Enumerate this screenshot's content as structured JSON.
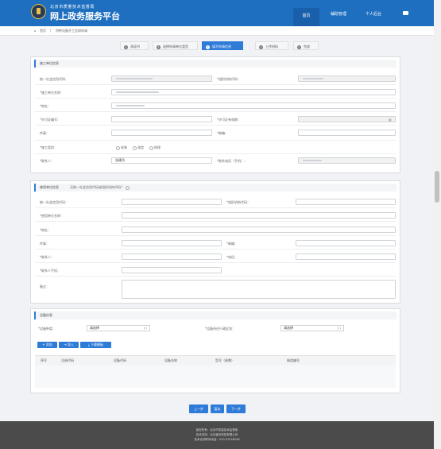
{
  "header": {
    "org": "北京市质量技术监督局",
    "title": "网上政务服务平台",
    "nav": [
      "首页",
      "辅助管理",
      "个人后台"
    ],
    "colors": {
      "primary": "#1e6fbf",
      "accent": "#2f7bd8"
    }
  },
  "breadcrumb": [
    "首页",
    "特种设备开工告知申请"
  ],
  "steps": [
    {
      "num": "1",
      "label": "承诺书"
    },
    {
      "num": "2",
      "label": "选择申请单位类型"
    },
    {
      "num": "3",
      "label": "填写申请信息"
    },
    {
      "num": "4",
      "label": "上传材料"
    },
    {
      "num": "5",
      "label": "完成"
    }
  ],
  "active_step": 3,
  "construction": {
    "title": "施工单位信息",
    "credit_code": "统一社会信用代码：",
    "org_code": "*组织机构代码：",
    "name": "*施工单位名称：",
    "address": "*地址：",
    "license_no": "*许可证编号：",
    "license_expiry": "*许可证有效期：",
    "fax": "传真：",
    "postcode": "*邮编：",
    "category": "*施工类别：",
    "category_options": [
      "安装",
      "改造",
      "修理"
    ],
    "contact": "*联系人：",
    "contact_value": "张建功",
    "phone": "*联系电话（手机）："
  },
  "user": {
    "title": "使用单位信息",
    "note": "无统一社会信用代码或组织机构代码？",
    "credit_code": "统一社会信用代码：",
    "org_code": "*组织机构代码：",
    "name": "*使用单位名称：",
    "address": "*地址：",
    "fax": "传真：",
    "postcode": "*邮编：",
    "contact": "*联系人：",
    "tel": "*电话：",
    "mobile": "*联系人手机：",
    "remark": "备注："
  },
  "equipment": {
    "title": "设备信息",
    "type_label": "*设备种类：",
    "type_value": "请选择",
    "district_label": "*设备所在行政区划：",
    "district_value": "请选择",
    "buttons": [
      "+ 添加",
      "导入",
      "下载模板"
    ],
    "columns": [
      "序号",
      "注册代码",
      "设备代码",
      "设备名称",
      "型号（参数）",
      "制造编号"
    ]
  },
  "actions": [
    "上一步",
    "暂存",
    "下一步"
  ],
  "footer": [
    "版权所有：北京市质量技术监督局",
    "技术支持：北京鑫欣科技有限公司",
    "技术支持联系电话：010-57528248"
  ]
}
